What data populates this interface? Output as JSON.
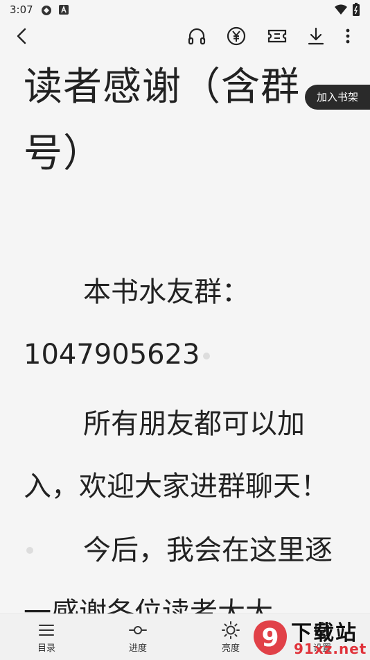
{
  "status_bar": {
    "time": "3:07"
  },
  "toolbar": {
    "icons": [
      "back-arrow-icon",
      "headphones-icon",
      "yuan-coin-icon",
      "ticket-icon",
      "download-icon",
      "more-vertical-icon"
    ]
  },
  "content": {
    "chapter_title": "读者感谢（含群号）",
    "paragraphs": [
      "本书水友群：1047905623",
      "所有朋友都可以加入，欢迎大家进群聊天！",
      "今后，我会在这里逐一感谢各位读者大大"
    ]
  },
  "add_to_shelf_label": "加入书架",
  "bottom_bar": {
    "items": [
      {
        "label": "目录",
        "icon": "list-icon"
      },
      {
        "label": "进度",
        "icon": "progress-slider-icon"
      },
      {
        "label": "亮度",
        "icon": "sun-icon"
      },
      {
        "label": "设置",
        "icon": "gear-icon"
      }
    ]
  },
  "watermark": {
    "line1": "下载站",
    "line2": "91xz.net",
    "logo_text": "9"
  },
  "colors": {
    "background": "#f5f5f5",
    "text": "#222222",
    "shelf_button": "#2a2a2a",
    "watermark_red": "#e0323a"
  }
}
